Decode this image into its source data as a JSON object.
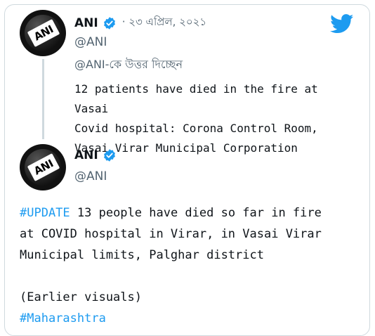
{
  "tweet_parent": {
    "author_name": "ANI",
    "date": "· ২৩ এপ্রিল, ২০২১",
    "handle": "@ANI",
    "replying_to": "@ANI-কে উত্তর দিচ্ছেন",
    "text_lines": [
      "12 patients have died in the fire at Vasai",
      "Covid hospital: Corona Control Room,",
      "Vasai Virar Municipal Corporation"
    ],
    "avatar_text": "ANI"
  },
  "tweet_main": {
    "author_name": "ANI",
    "handle": "@ANI",
    "hashtag_update": "#UPDATE",
    "line1_rest": " 13 people have died so far in fire",
    "line2": "at COVID hospital in Virar, in Vasai Virar",
    "line3": "Municipal limits, Palghar district",
    "visuals_note": "(Earlier visuals)",
    "hashtag_state": "#Maharashtra",
    "avatar_text": "ANI"
  },
  "colors": {
    "accent": "#1d9bf0",
    "muted": "#536471",
    "border": "#cfd9de"
  },
  "icons": [
    "verified-badge-icon",
    "twitter-bird-icon"
  ]
}
